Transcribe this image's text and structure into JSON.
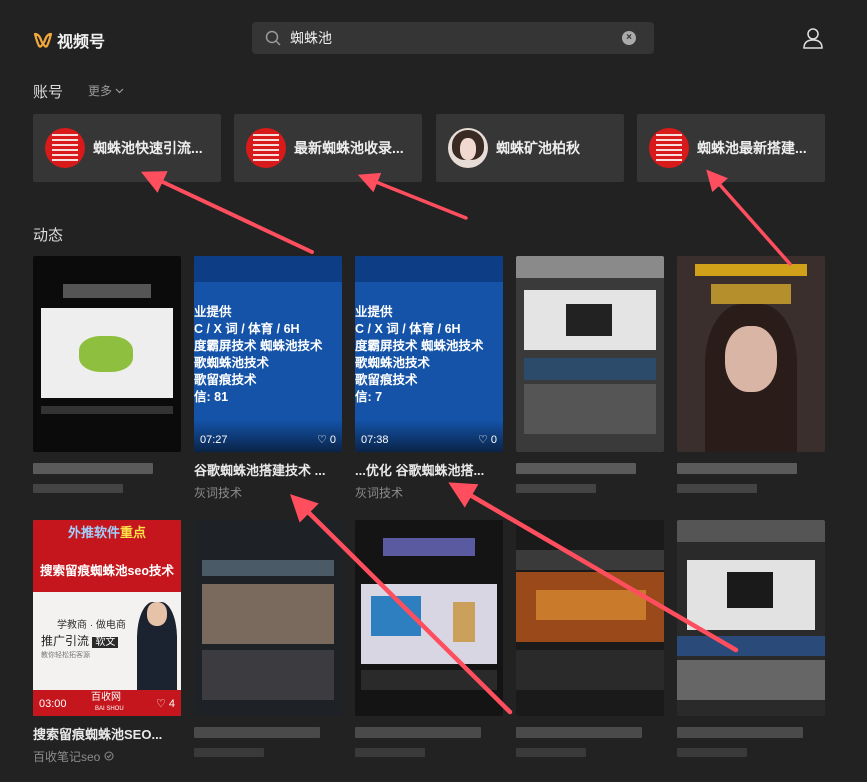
{
  "app": {
    "name": "视频号"
  },
  "search": {
    "value": "蜘蛛池",
    "clear_label": "×"
  },
  "sections": {
    "accounts": "账号",
    "more": "更多",
    "feed": "动态"
  },
  "accounts": [
    {
      "name": "蜘蛛池快速引流..."
    },
    {
      "name": "最新蜘蛛池收录..."
    },
    {
      "name": "蜘蛛矿池柏秋"
    },
    {
      "name": "蜘蛛池最新搭建..."
    }
  ],
  "row1": [
    {
      "title": "",
      "author": "",
      "duration": "",
      "likes": ""
    },
    {
      "title": "谷歌蜘蛛池搭建技术 ...",
      "author": "灰词技术",
      "duration": "07:27",
      "likes": "0",
      "ad_lines": [
        "业提供",
        "C / X 词 / 体育 / 6H",
        "度霸屏技术  蜘蛛池技术",
        "歌蜘蛛池技术",
        "歌留痕技术",
        "信: 81"
      ]
    },
    {
      "title": "...优化 谷歌蜘蛛池搭...",
      "author": "灰词技术",
      "duration": "07:38",
      "likes": "0",
      "ad_lines": [
        "业提供",
        "C / X 词 / 体育 / 6H",
        "度霸屏技术  蜘蛛池技术",
        "歌蜘蛛池技术",
        "歌留痕技术",
        "信: 7"
      ]
    },
    {
      "title": "",
      "author": "",
      "duration": "",
      "likes": ""
    },
    {
      "title": "",
      "author": "",
      "duration": "",
      "likes": ""
    }
  ],
  "row2": [
    {
      "title": "搜索留痕蜘蛛池SEO...",
      "author": "百收笔记seo",
      "duration": "03:00",
      "likes": "4",
      "poster": {
        "top": "外推软件",
        "top_accent": "重点",
        "headline": "搜索留痕蜘蛛池seo技术",
        "sub1": "学教商 · 做电商",
        "sub2": "推广引流",
        "tag": "软文",
        "small": "教你轻松拓客源",
        "brand": "百收网",
        "brand_en": "BAI SHOU"
      }
    },
    {
      "title": "",
      "author": ""
    },
    {
      "title": "",
      "author": ""
    },
    {
      "title": "",
      "author": ""
    },
    {
      "title": "",
      "author": ""
    }
  ],
  "colors": {
    "background": "#222223",
    "card": "#363637",
    "arrow": "#ff4e5e",
    "accent": "#f2a93b"
  }
}
